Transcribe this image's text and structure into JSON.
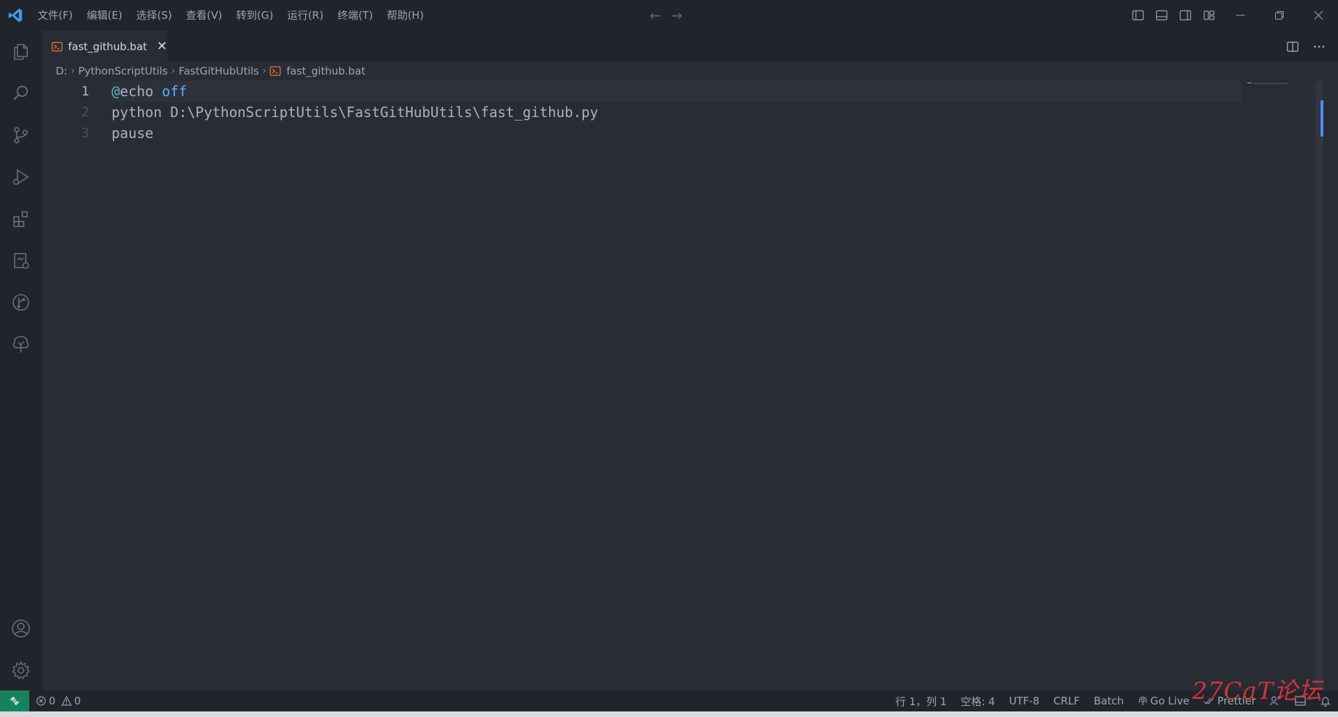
{
  "menu": [
    "文件(F)",
    "编辑(E)",
    "选择(S)",
    "查看(V)",
    "转到(G)",
    "运行(R)",
    "终端(T)",
    "帮助(H)"
  ],
  "tab": {
    "label": "fast_github.bat",
    "close": "✕"
  },
  "breadcrumb": [
    "D:",
    "PythonScriptUtils",
    "FastGitHubUtils",
    "fast_github.bat"
  ],
  "editor": {
    "lines": [
      {
        "num": "1",
        "at": "@",
        "cmd": "echo ",
        "kw": "off"
      },
      {
        "num": "2",
        "text": "python D:\\PythonScriptUtils\\FastGitHubUtils\\fast_github.py"
      },
      {
        "num": "3",
        "text": "pause"
      }
    ]
  },
  "statusbar": {
    "errors": "0",
    "warnings": "0",
    "cursor": "行 1，列 1",
    "indent": "空格: 4",
    "encoding": "UTF-8",
    "eol": "CRLF",
    "language": "Batch",
    "golive": "Go Live",
    "prettier": "Prettier"
  },
  "watermark": "27CaT论坛",
  "colors": {
    "accent": "#528bff",
    "remote": "#16825d",
    "bat_icon": "#e06c3c",
    "watermark": "#e0373b"
  }
}
